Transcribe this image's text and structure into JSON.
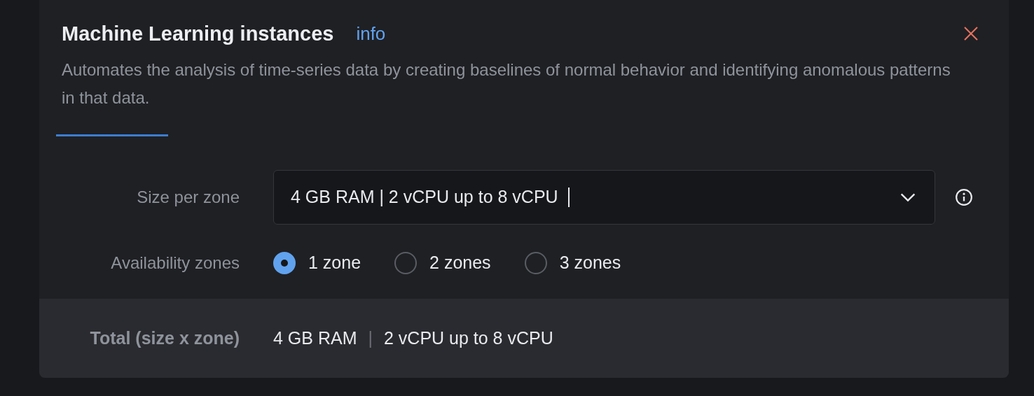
{
  "panel": {
    "title": "Machine Learning instances",
    "info_link": "info",
    "description": "Automates the analysis of time-series data by creating baselines of normal behavior and identifying anomalous patterns in that data."
  },
  "size": {
    "label": "Size per zone",
    "value": "4 GB RAM | 2 vCPU up to 8 vCPU"
  },
  "zones": {
    "label": "Availability zones",
    "options": [
      {
        "label": "1 zone",
        "selected": true
      },
      {
        "label": "2 zones",
        "selected": false
      },
      {
        "label": "3 zones",
        "selected": false
      }
    ]
  },
  "total": {
    "label": "Total (size x zone)",
    "ram": "4 GB RAM",
    "separator": "|",
    "cpu": "2 vCPU up to 8 vCPU"
  }
}
